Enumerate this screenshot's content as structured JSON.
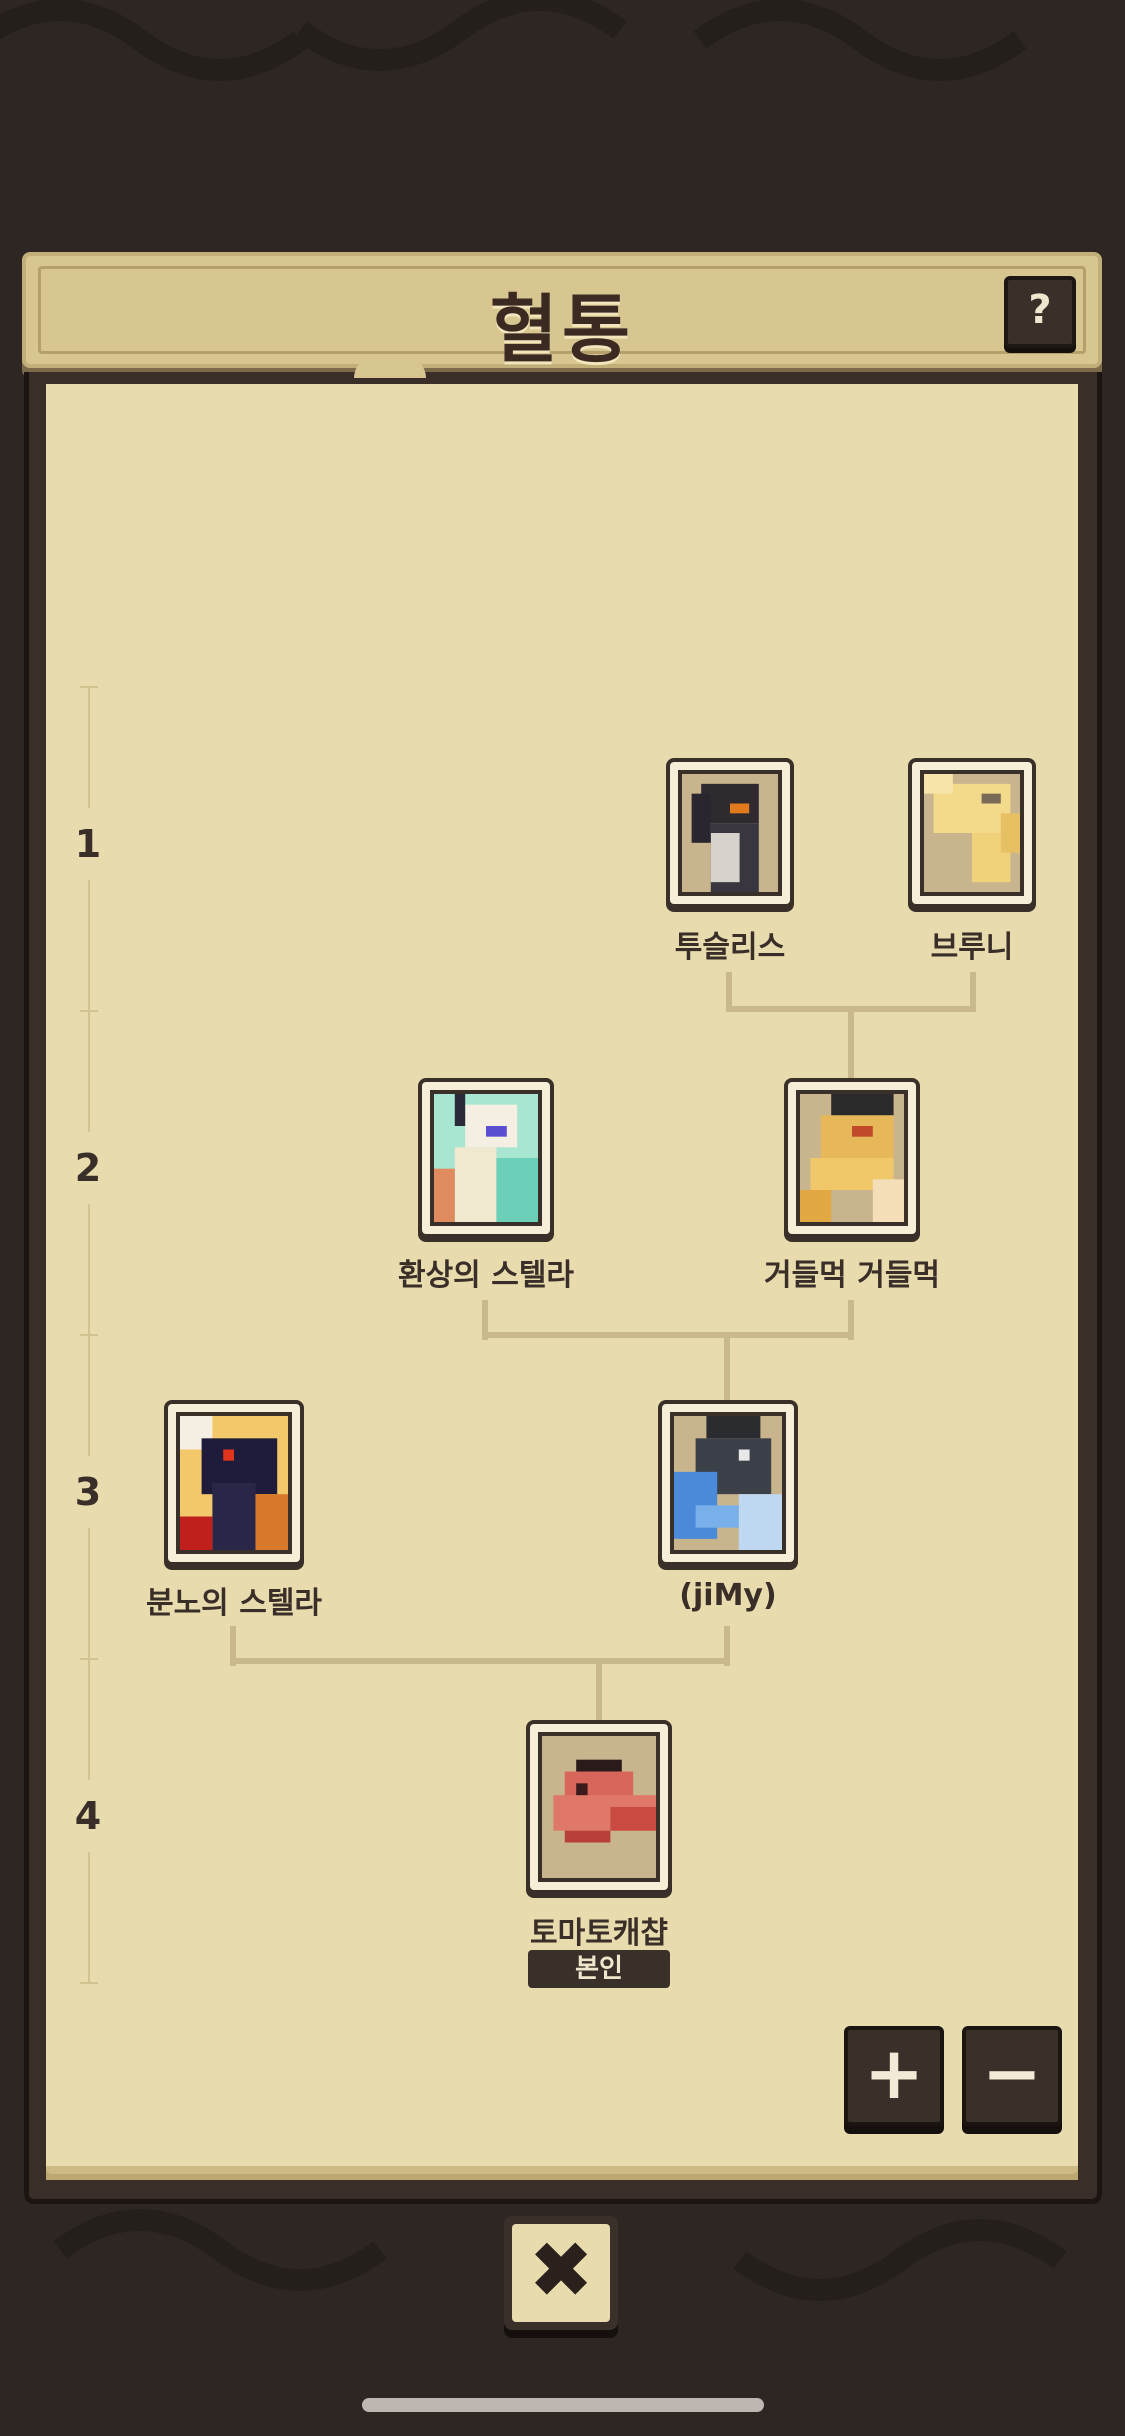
{
  "header": {
    "title": "혈통",
    "help_label": "?"
  },
  "generations": [
    "1",
    "2",
    "3",
    "4"
  ],
  "cards": {
    "tuslis": "투슬리스",
    "bruni": "브루니",
    "fantasy_stella": "환상의 스텔라",
    "geodeulmeok": "거들먹 거들먹",
    "rage_stella": "분노의 스텔라",
    "jimy": "(jiMy)",
    "tomato": "토마토캐챱"
  },
  "self_badge": "본인",
  "zoom": {
    "in_label": "+",
    "out_label": "−"
  },
  "close_label": "✖",
  "colors": {
    "background": "#2e2622",
    "parchment": "#e8dcaf",
    "frame": "#3a302a",
    "line": "#cbb98e"
  }
}
